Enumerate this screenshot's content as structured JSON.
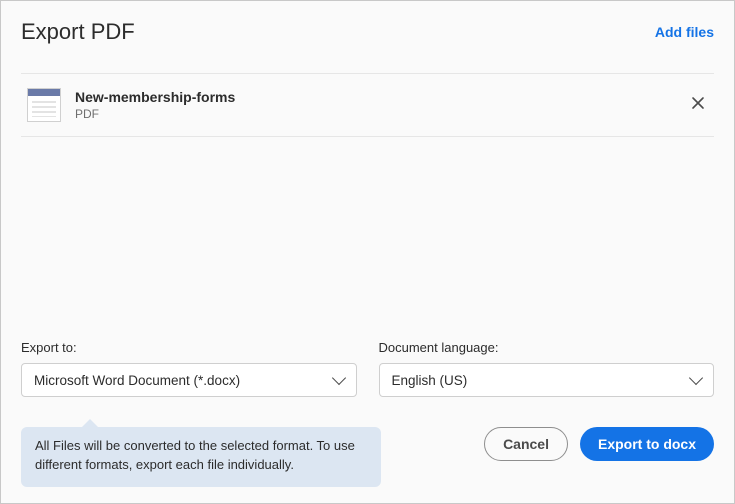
{
  "header": {
    "title": "Export PDF",
    "add_files": "Add files"
  },
  "files": [
    {
      "name": "New-membership-forms",
      "type": "PDF"
    }
  ],
  "export_to": {
    "label": "Export to:",
    "value": "Microsoft Word Document (*.docx)"
  },
  "language": {
    "label": "Document language:",
    "value": "English (US)"
  },
  "tooltip": "All Files will be converted to the selected format. To use different formats, export each file individually.",
  "buttons": {
    "cancel": "Cancel",
    "export": "Export to docx"
  }
}
